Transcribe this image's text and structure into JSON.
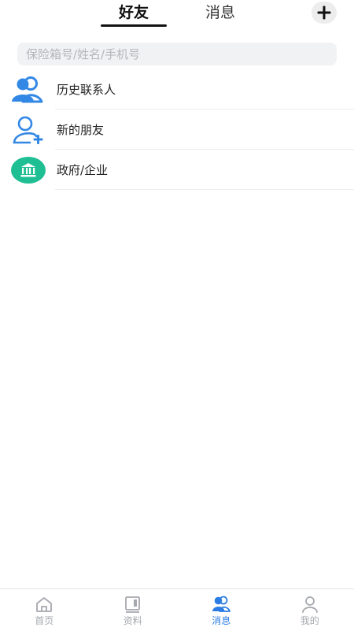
{
  "header": {
    "tabs": [
      {
        "label": "好友",
        "active": true
      },
      {
        "label": "消息",
        "active": false
      }
    ],
    "add_icon": "plus-icon"
  },
  "search": {
    "placeholder": "保险箱号/姓名/手机号",
    "value": ""
  },
  "list": {
    "items": [
      {
        "label": "历史联系人",
        "icon": "contacts-icon"
      },
      {
        "label": "新的朋友",
        "icon": "add-friend-icon"
      },
      {
        "label": "政府/企业",
        "icon": "government-icon"
      }
    ]
  },
  "bottom_nav": {
    "items": [
      {
        "label": "首页",
        "icon": "home-icon",
        "active": false
      },
      {
        "label": "资料",
        "icon": "documents-icon",
        "active": false
      },
      {
        "label": "消息",
        "icon": "messages-icon",
        "active": true
      },
      {
        "label": "我的",
        "icon": "profile-icon",
        "active": false
      }
    ]
  },
  "colors": {
    "accent": "#2b7de4",
    "icon_blue": "#3388e6",
    "government_green": "#1fbf93",
    "inactive": "#a5a8ad"
  }
}
